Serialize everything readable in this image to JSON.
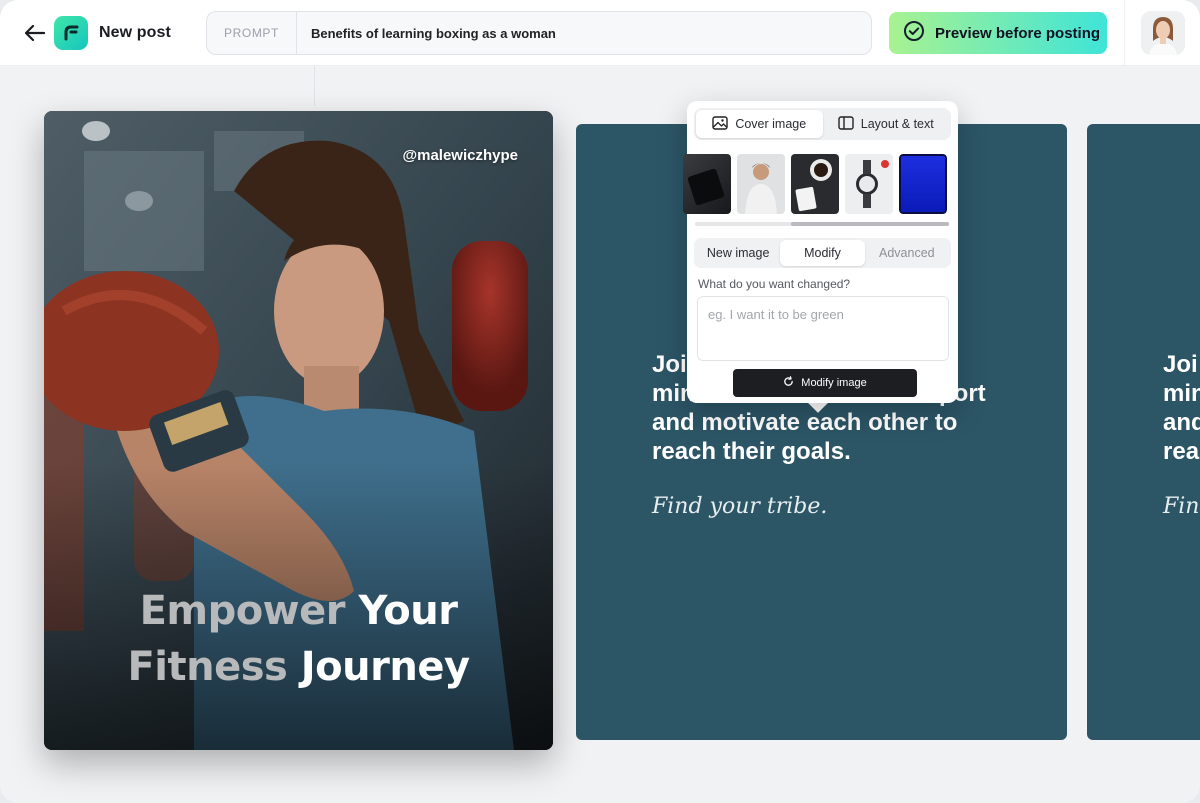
{
  "header": {
    "title": "New post",
    "prompt_label": "PROMPT",
    "prompt_value": "Benefits of learning boxing as a woman",
    "preview_button": "Preview before posting"
  },
  "card1": {
    "handle": "@malewiczhype",
    "headline_word1": "Empower",
    "headline_word2": "Your",
    "headline_word3": "Fitness",
    "headline_word4": "Journey"
  },
  "card2": {
    "body_line1": "Join",
    "body_line2": "min",
    "body_line2_end": "port",
    "body_line3": "and motivate each other to",
    "body_line4": "reach their goals.",
    "tagline": "Find your tribe."
  },
  "card3": {
    "body_line1": "Joi",
    "body_line2": "min",
    "body_line3": "and",
    "body_line4": "rea",
    "tagline": "Find"
  },
  "popover": {
    "tab_cover": "Cover image",
    "tab_layout": "Layout & text",
    "mode_new": "New image",
    "mode_modify": "Modify",
    "mode_advanced": "Advanced",
    "question": "What do you want changed?",
    "placeholder": "eg. I want it to be green",
    "modify_button": "Modify image"
  },
  "colors": {
    "card_teal": "#2c5566",
    "preview_gradient_start": "#a8f291",
    "preview_gradient_end": "#3fe4d8",
    "selected_thumb": "#1a2fd6"
  }
}
